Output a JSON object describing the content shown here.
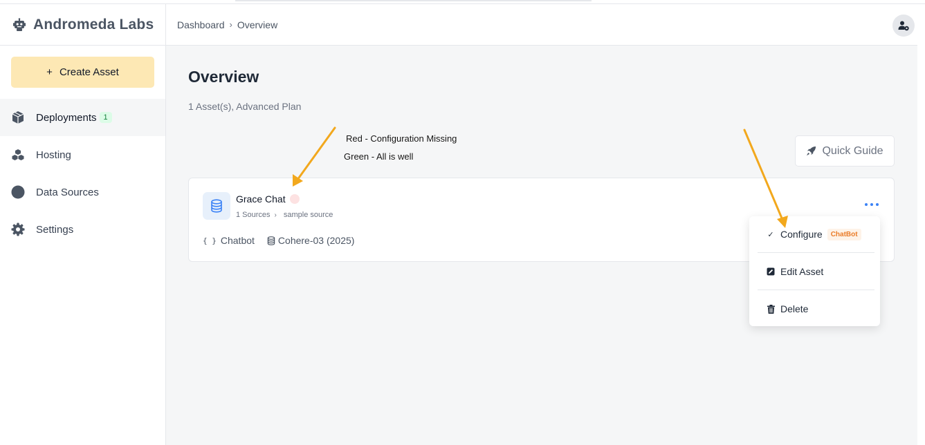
{
  "brand": {
    "title": "Andromeda Labs",
    "icon": "robot-icon"
  },
  "sidebar": {
    "create_label": "Create Asset",
    "items": [
      {
        "label": "Deployments",
        "icon": "cube-icon",
        "badge": "1",
        "active": true
      },
      {
        "label": "Hosting",
        "icon": "cubes-icon"
      },
      {
        "label": "Data Sources",
        "icon": "circle-icon"
      },
      {
        "label": "Settings",
        "icon": "gear-icon"
      }
    ]
  },
  "header": {
    "breadcrumb": [
      "Dashboard",
      "Overview"
    ],
    "breadcrumb_sep": "›",
    "avatar_icon": "user-gear-icon"
  },
  "main": {
    "title": "Overview",
    "subtitle": "1 Asset(s), Advanced Plan",
    "quick_guide_label": "Quick Guide",
    "annotations": {
      "red": "Red - Configuration Missing",
      "green": "Green - All is well"
    }
  },
  "asset": {
    "name": "Grace Chat",
    "status_color": "#fde2e2",
    "sources_count": "1 Sources",
    "source_name": "sample source",
    "type": "Chatbot",
    "model": "Cohere-03 (2025)"
  },
  "menu": {
    "configure_label": "Configure",
    "configure_badge": "ChatBot",
    "edit_label": "Edit Asset",
    "delete_label": "Delete"
  },
  "colors": {
    "accent": "#3b82f6",
    "create_button": "#fde8b4",
    "arrow": "#f2a81d",
    "chatbot_badge": "#ea7c28"
  }
}
